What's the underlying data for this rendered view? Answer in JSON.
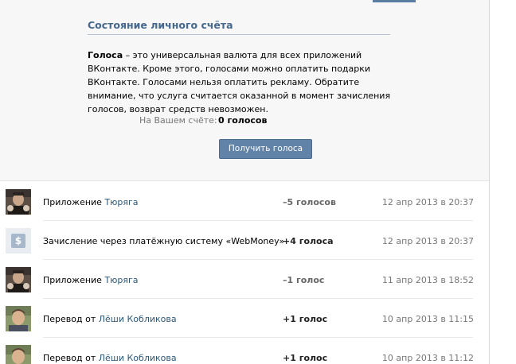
{
  "balance_section": {
    "title": "Состояние личного счёта",
    "description_bold": "Голоса",
    "description_rest": " – это универсальная валюта для всех приложений ВКонтакте. Кроме этого, голосами можно оплатить подарки ВКонтакте. Голосами нельзя оплатить рекламу. Обратите внимание, что услуга считается оказанной в момент зачисления голосов, возврат средств невозможен.",
    "balance_label": "На Вашем счёте:",
    "balance_value": "0 голосов",
    "get_votes_label": "Получить голоса"
  },
  "transactions": [
    {
      "desc_prefix": "Приложение ",
      "desc_link": "Тюряга",
      "amount": "–5 голосов",
      "date": "12 апр 2013 в 20:37",
      "icon": "app-avatar",
      "sign": "neg"
    },
    {
      "desc_prefix": "Зачисление через платёжную систему «WebMoney»",
      "desc_link": "",
      "amount": "+4 голоса",
      "date": "12 апр 2013 в 20:37",
      "icon": "dollar-icon",
      "sign": "pos"
    },
    {
      "desc_prefix": "Приложение ",
      "desc_link": "Тюряга",
      "amount": "–1 голос",
      "date": "11 апр 2013 в 18:52",
      "icon": "app-avatar",
      "sign": "neg"
    },
    {
      "desc_prefix": "Перевод от ",
      "desc_link": "Лёши Кобликова",
      "amount": "+1 голос",
      "date": "10 апр 2013 в 11:15",
      "icon": "user-avatar",
      "sign": "pos"
    },
    {
      "desc_prefix": "Перевод от ",
      "desc_link": "Лёши Кобликова",
      "amount": "+1 голос",
      "date": "10 апр 2013 в 11:12",
      "icon": "user-avatar",
      "sign": "pos"
    }
  ],
  "colors": {
    "accent": "#45688e",
    "button": "#6083a7",
    "link": "#2b587a"
  }
}
